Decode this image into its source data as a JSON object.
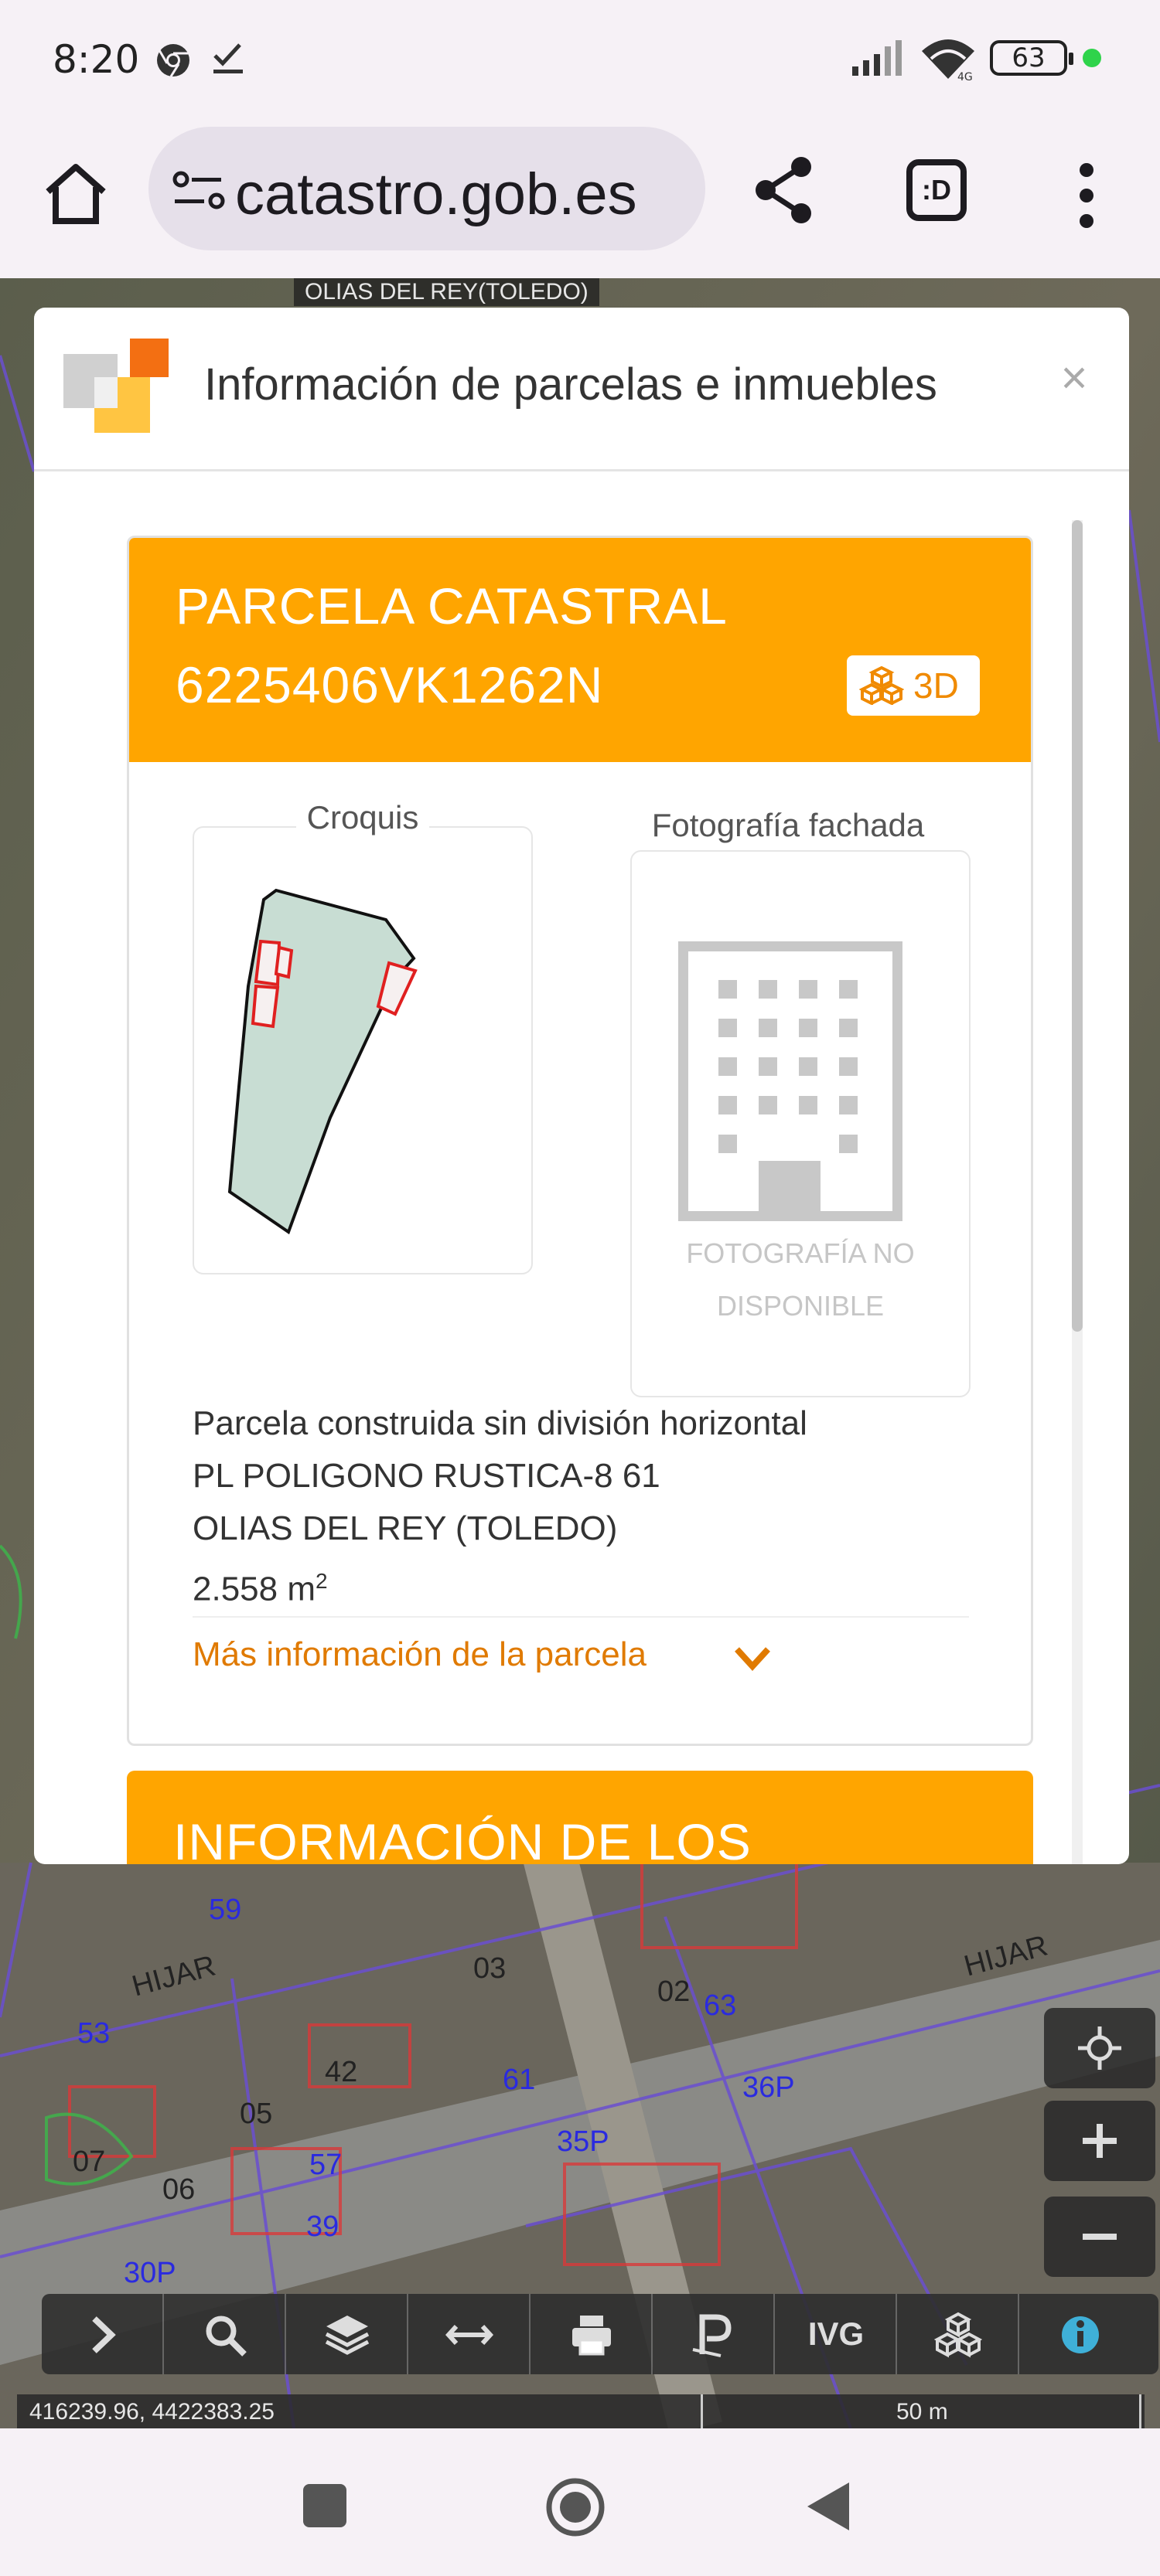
{
  "status_bar": {
    "time": "8:20",
    "battery": "63"
  },
  "browser": {
    "url": "catastro.gob.es",
    "tab_label": ":D"
  },
  "map": {
    "top_label": "OLIAS DEL REY(TOLEDO)",
    "overlay_labels": [
      "03",
      "02",
      "42",
      "HIJAR",
      "HIJAR",
      "05",
      "06",
      "07",
      "63",
      "61",
      "36P",
      "35P",
      "57",
      "39",
      "30P",
      "59",
      "53"
    ]
  },
  "modal": {
    "title": "Información de parcelas e inmuebles",
    "close": "×",
    "card": {
      "type": "PARCELA CATASTRAL",
      "reference": "6225406VK1262N",
      "btn_3d": "3D",
      "croquis_label": "Croquis",
      "foto_label": "Fotografía fachada",
      "foto_unavailable": "FOTOGRAFÍA NO DISPONIBLE",
      "description": [
        "Parcela construida sin división horizontal",
        "PL POLIGONO RUSTICA-8 61",
        "OLIAS DEL REY (TOLEDO)"
      ],
      "area_value": "2.558 m",
      "area_sup": "2",
      "more_info": "Más información de la parcela"
    },
    "card2_title": "INFORMACIÓN DE LOS"
  },
  "toolbar": {
    "ivg_label": "IVG"
  },
  "coords": "416239.96, 4422383.25",
  "scale": "50 m",
  "colors": {
    "accent": "#ffa500",
    "link": "#e07a00"
  }
}
